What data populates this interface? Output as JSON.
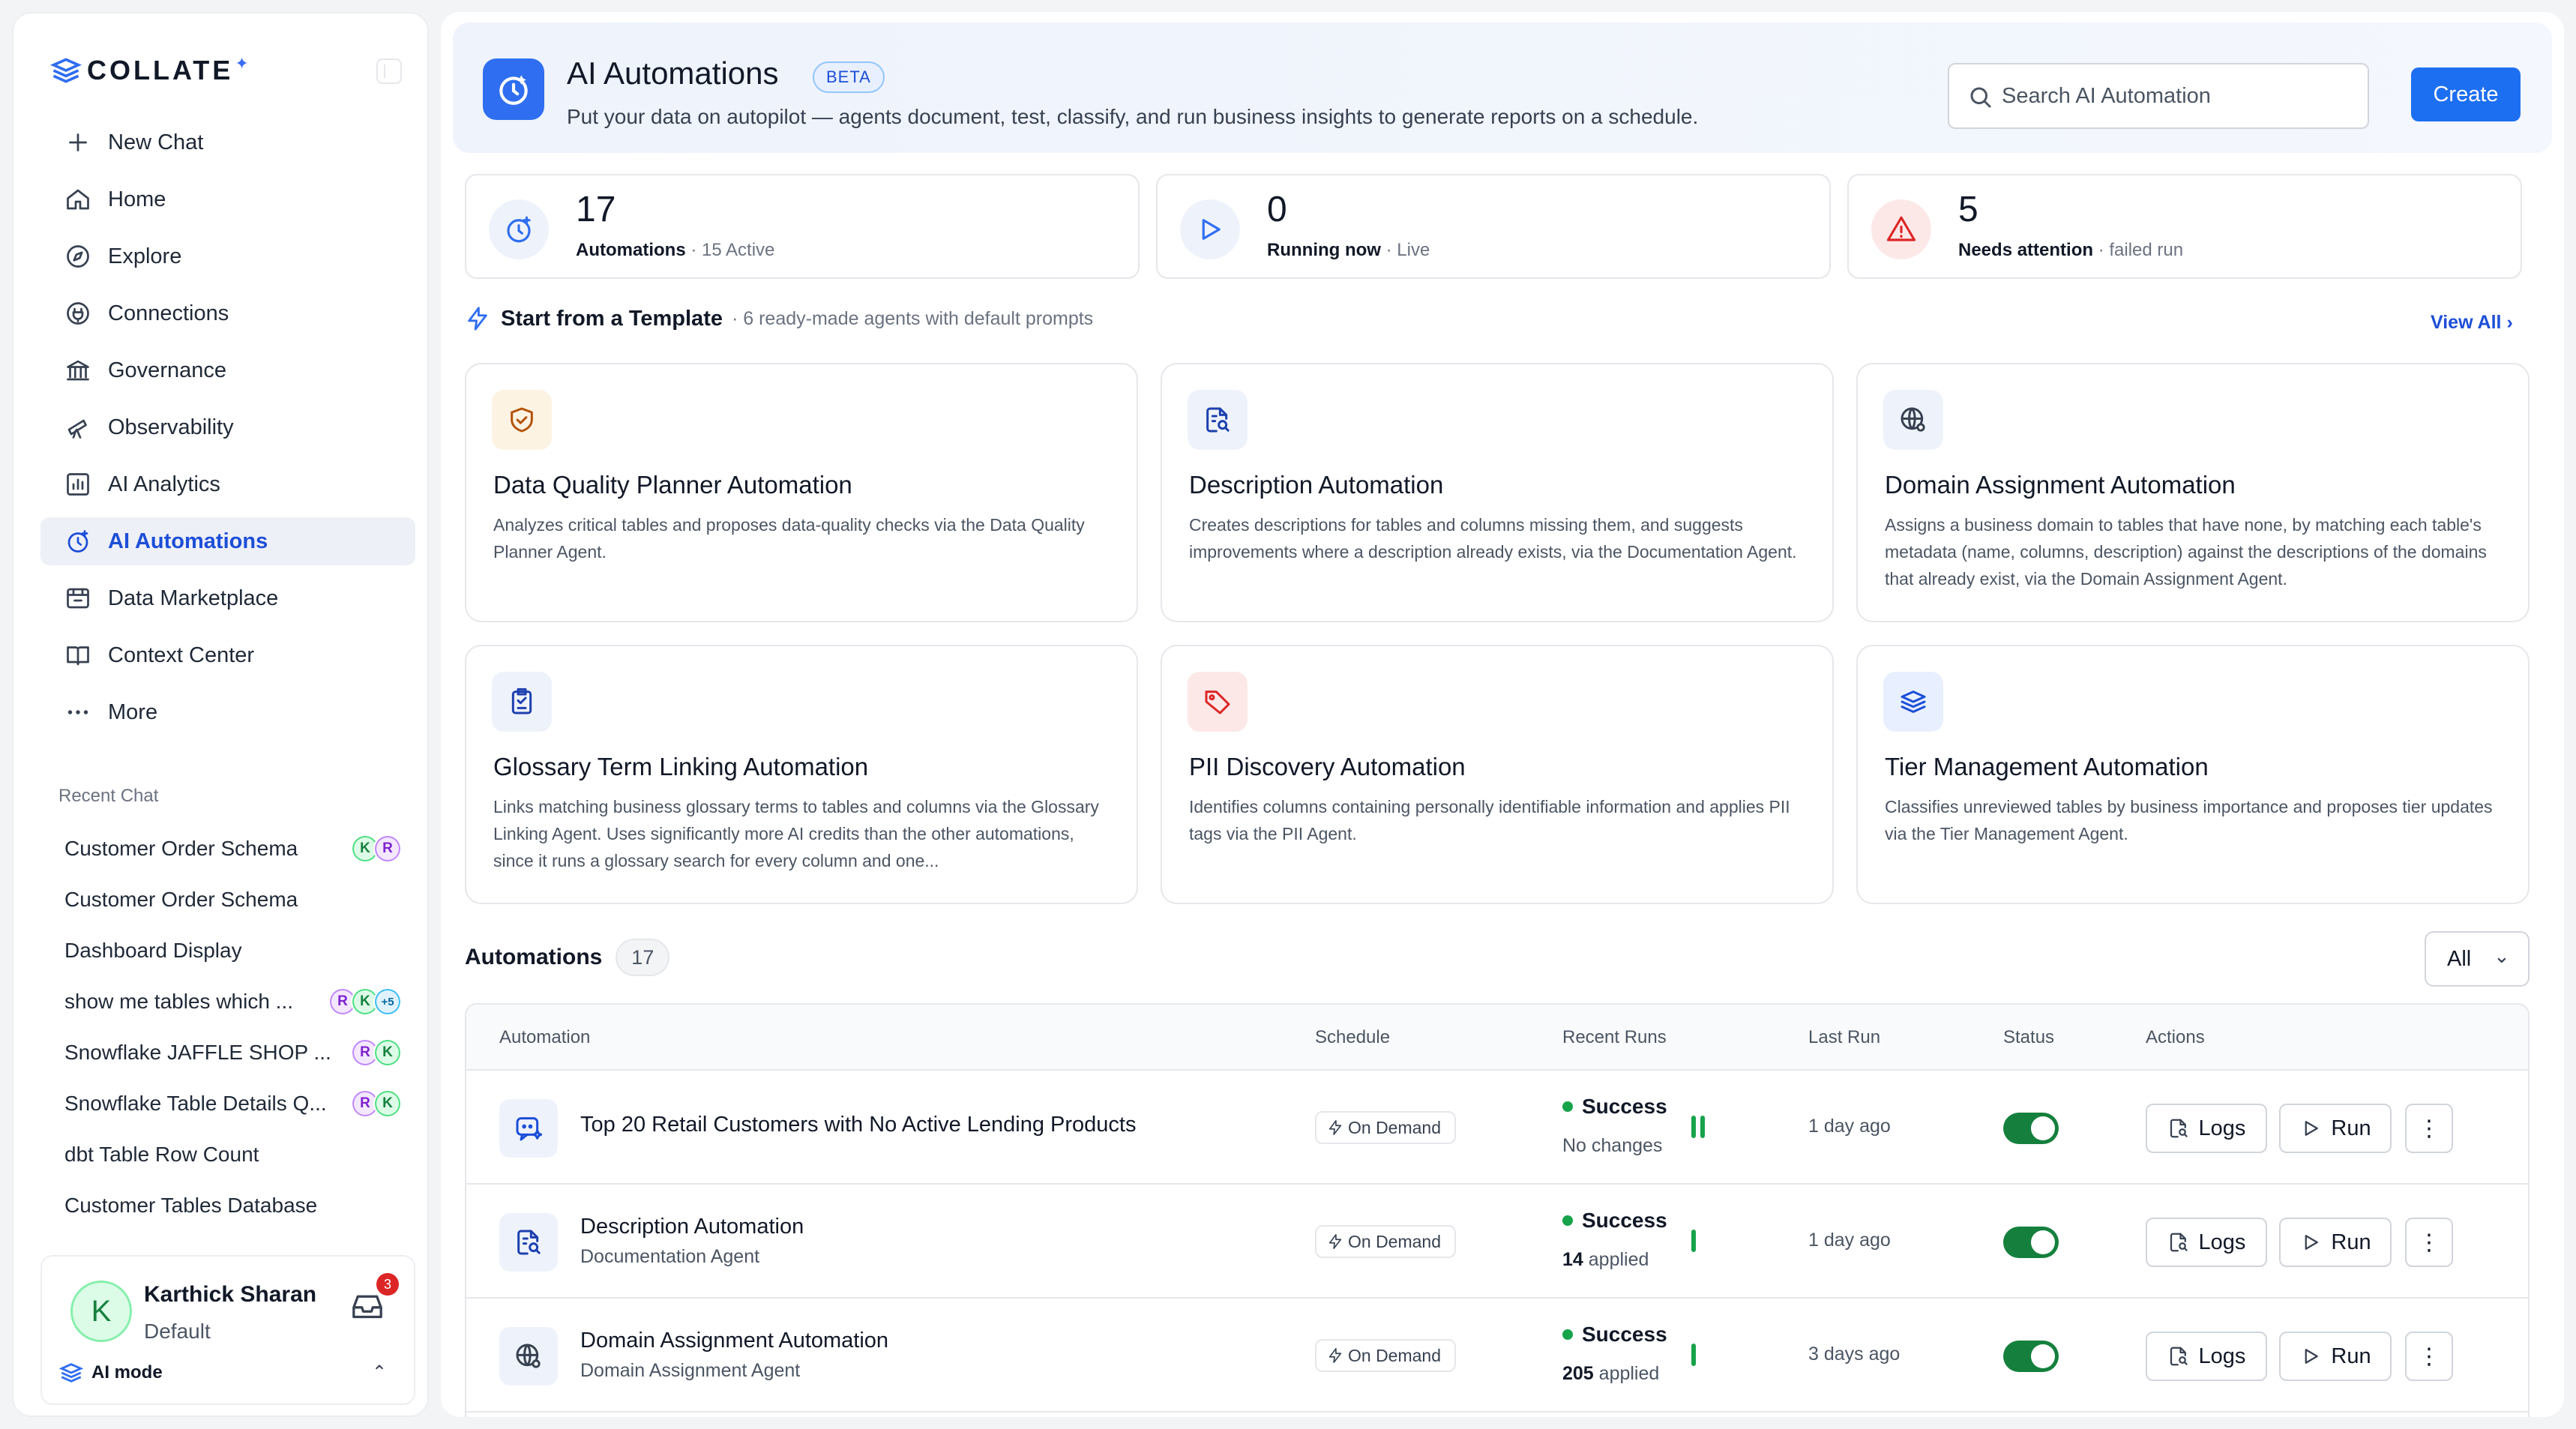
{
  "sidebar": {
    "brand": "COLLATE",
    "nav": [
      {
        "label": "New Chat",
        "icon": "plus-icon"
      },
      {
        "label": "Home",
        "icon": "home-icon"
      },
      {
        "label": "Explore",
        "icon": "compass-icon"
      },
      {
        "label": "Connections",
        "icon": "plug-icon"
      },
      {
        "label": "Governance",
        "icon": "bank-icon"
      },
      {
        "label": "Observability",
        "icon": "telescope-icon"
      },
      {
        "label": "AI Analytics",
        "icon": "chart-icon"
      },
      {
        "label": "AI Automations",
        "icon": "automation-icon",
        "active": true
      },
      {
        "label": "Data Marketplace",
        "icon": "store-icon"
      },
      {
        "label": "Context Center",
        "icon": "book-icon"
      },
      {
        "label": "More",
        "icon": "dots-icon"
      }
    ],
    "recent_title": "Recent Chat",
    "recent": [
      {
        "label": "Customer Order Schema",
        "avatars": [
          "K",
          "R"
        ]
      },
      {
        "label": "Customer Order Schema",
        "avatars": []
      },
      {
        "label": "Dashboard Display",
        "avatars": []
      },
      {
        "label": "show me tables which ...",
        "avatars": [
          "R",
          "K",
          "+5"
        ]
      },
      {
        "label": "Snowflake JAFFLE SHOP ...",
        "avatars": [
          "R",
          "K"
        ]
      },
      {
        "label": "Snowflake Table Details Q...",
        "avatars": [
          "R",
          "K"
        ]
      },
      {
        "label": "dbt Table Row Count",
        "avatars": []
      },
      {
        "label": "Customer Tables Database",
        "avatars": []
      }
    ],
    "user": {
      "initial": "K",
      "name": "Karthick Sharan",
      "role": "Default",
      "notifications": "3",
      "mode": "AI mode"
    }
  },
  "header": {
    "title": "AI Automations",
    "badge": "BETA",
    "subtitle": "Put your data on autopilot — agents document, test, classify, and run business insights to generate reports on a schedule.",
    "search_placeholder": "Search AI Automation",
    "create_label": "Create"
  },
  "stats": [
    {
      "value": "17",
      "label": "Automations",
      "detail": " · 15 Active",
      "accent": "#2f6ef0"
    },
    {
      "value": "0",
      "label": "Running now",
      "detail": " · Live",
      "accent": "#2f6ef0"
    },
    {
      "value": "5",
      "label": "Needs attention",
      "detail": " · failed run",
      "accent": "#dc2626"
    }
  ],
  "templates": {
    "title": "Start from a Template",
    "subtitle": "· 6 ready-made agents with default prompts",
    "view_all": "View All",
    "cards": [
      {
        "title": "Data Quality Planner Automation",
        "desc": "Analyzes critical tables and proposes data-quality checks via the Data Quality Planner Agent.",
        "icon": "shield-check-icon"
      },
      {
        "title": "Description Automation",
        "desc": "Creates descriptions for tables and columns missing them, and suggests improvements where a description already exists, via the Documentation Agent.",
        "icon": "document-search-icon"
      },
      {
        "title": "Domain Assignment Automation",
        "desc": "Assigns a business domain to tables that have none, by matching each table's metadata (name, columns, description) against the descriptions of the domains that already exist, via the Domain Assignment Agent.",
        "icon": "globe-gear-icon"
      },
      {
        "title": "Glossary Term Linking Automation",
        "desc": "Links matching business glossary terms to tables and columns via the Glossary Linking Agent. Uses significantly more AI credits than the other automations, since it runs a glossary search for every column and one...",
        "icon": "clipboard-icon"
      },
      {
        "title": "PII Discovery Automation",
        "desc": "Identifies columns containing personally identifiable information and applies PII tags via the PII Agent.",
        "icon": "tag-icon"
      },
      {
        "title": "Tier Management Automation",
        "desc": "Classifies unreviewed tables by business importance and proposes tier updates via the Tier Management Agent.",
        "icon": "layers-icon"
      }
    ]
  },
  "automations": {
    "title": "Automations",
    "count": "17",
    "filter": "All",
    "columns": [
      "Automation",
      "Schedule",
      "Recent Runs",
      "Last Run",
      "Status",
      "Actions"
    ],
    "rows": [
      {
        "name": "Top 20 Retail Customers with No Active Lending Products",
        "agent": "",
        "schedule": "On Demand",
        "status": "Success",
        "note_bold": "",
        "note": "No changes",
        "bars": 2,
        "last_run": "1 day ago",
        "enabled": true,
        "icon": "chat-sparkle-icon"
      },
      {
        "name": "Description Automation",
        "agent": "Documentation Agent",
        "schedule": "On Demand",
        "status": "Success",
        "note_bold": "14",
        "note": " applied",
        "bars": 1,
        "last_run": "1 day ago",
        "enabled": true,
        "icon": "document-search-icon"
      },
      {
        "name": "Domain Assignment Automation",
        "agent": "Domain Assignment Agent",
        "schedule": "On Demand",
        "status": "Success",
        "note_bold": "205",
        "note": " applied",
        "bars": 1,
        "last_run": "3 days ago",
        "enabled": true,
        "icon": "globe-gear-icon"
      }
    ],
    "logs_label": "Logs",
    "run_label": "Run",
    "more_label": "⋮"
  }
}
